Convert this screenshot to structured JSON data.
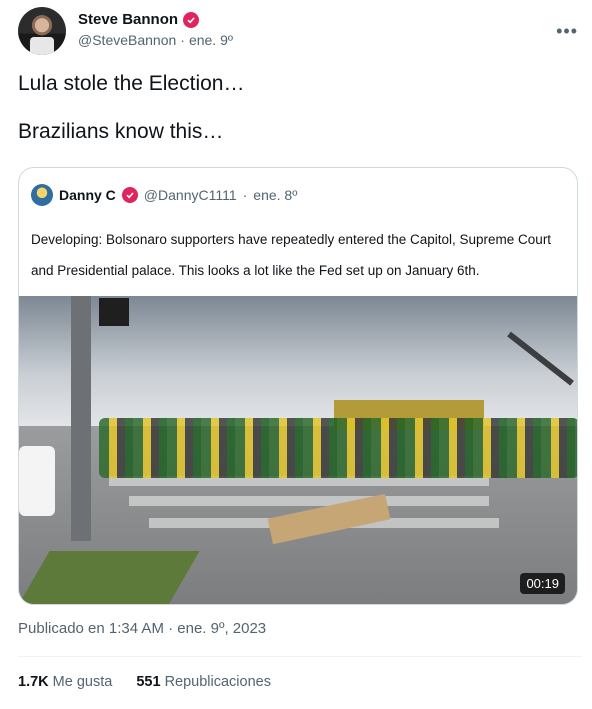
{
  "tweet": {
    "author_name": "Steve Bannon",
    "author_handle": "@SteveBannon",
    "separator": "·",
    "date": "ene. 9º",
    "text_line1": "Lula stole the Election…",
    "text_line2": "Brazilians know this…",
    "more_icon": "more-horizontal-icon",
    "verified_color": "#e0245e"
  },
  "quote": {
    "author_name": "Danny C",
    "author_handle": "@DannyC1111",
    "separator": "·",
    "date": "ene. 8º",
    "text": "Developing: Bolsonaro supporters have repeatedly entered the Capitol, Supreme Court and Presidential palace. This looks a lot like the Fed set up on January 6th.",
    "video_duration": "00:19"
  },
  "footer": {
    "timestamp": "Publicado en 1:34 AM · ene. 9º, 2023",
    "likes_count": "1.7K",
    "likes_label": "Me gusta",
    "reposts_count": "551",
    "reposts_label": "Republicaciones"
  },
  "colors": {
    "text": "#0f1419",
    "secondary": "#536471",
    "border": "#cfd9de"
  }
}
